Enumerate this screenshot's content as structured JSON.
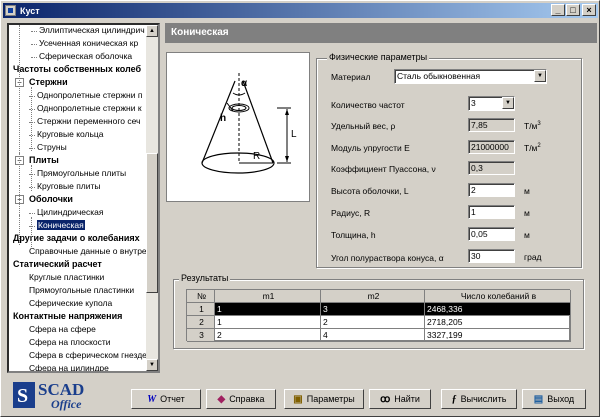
{
  "window": {
    "title": "Куст",
    "minimize": "_",
    "maximize": "□",
    "close": "×"
  },
  "tree": {
    "items": [
      {
        "label": "Эллиптическая цилиндрич",
        "level": 3,
        "bold": false
      },
      {
        "label": "Усеченная коническая кр",
        "level": 3,
        "bold": false
      },
      {
        "label": "Сферическая оболочка",
        "level": 3,
        "bold": false
      },
      {
        "label": "Частоты собственных колеб",
        "level": 0,
        "bold": true
      },
      {
        "label": "Стержни",
        "level": 1,
        "bold": true,
        "expander": "−"
      },
      {
        "label": "Однопролетные стержни п",
        "level": 2,
        "bold": false
      },
      {
        "label": "Однопролетные стержни к",
        "level": 2,
        "bold": false
      },
      {
        "label": "Стержни переменного сеч",
        "level": 2,
        "bold": false
      },
      {
        "label": "Круговые кольца",
        "level": 2,
        "bold": false
      },
      {
        "label": "Струны",
        "level": 2,
        "bold": false
      },
      {
        "label": "Плиты",
        "level": 1,
        "bold": true,
        "expander": "−"
      },
      {
        "label": "Прямоугольные плиты",
        "level": 2,
        "bold": false
      },
      {
        "label": "Круговые плиты",
        "level": 2,
        "bold": false
      },
      {
        "label": "Оболочки",
        "level": 1,
        "bold": true,
        "expander": "−"
      },
      {
        "label": "Цилиндрическая",
        "level": 2,
        "bold": false
      },
      {
        "label": "Коническая",
        "level": 2,
        "bold": false,
        "selected": true
      },
      {
        "label": "Другие задачи о колебаниях",
        "level": 0,
        "bold": true
      },
      {
        "label": "Справочные данные о внутре",
        "level": 1,
        "bold": false
      },
      {
        "label": "Статический расчет",
        "level": 0,
        "bold": true
      },
      {
        "label": "Круглые пластинки",
        "level": 1,
        "bold": false
      },
      {
        "label": "Прямоугольные пластинки",
        "level": 1,
        "bold": false
      },
      {
        "label": "Сферические купола",
        "level": 1,
        "bold": false
      },
      {
        "label": "Контактные напряжения",
        "level": 0,
        "bold": true
      },
      {
        "label": "Сфера на сфере",
        "level": 1,
        "bold": false
      },
      {
        "label": "Сфера на плоскости",
        "level": 1,
        "bold": false
      },
      {
        "label": "Сфера в сферическом гнезде",
        "level": 1,
        "bold": false
      },
      {
        "label": "Сфера на цилиндре",
        "level": 1,
        "bold": false
      }
    ]
  },
  "panel": {
    "title": "Коническая"
  },
  "figure": {
    "alpha": "α",
    "h": "h",
    "L": "L",
    "R": "R"
  },
  "params": {
    "legend": "Физические параметры",
    "material_label": "Материал",
    "material_value": "Сталь обыкновенная",
    "freq_label": "Количество частот",
    "freq_value": "3",
    "weight_label": "Удельный вес, ρ",
    "weight_value": "7,85",
    "weight_unit": "T/м",
    "weight_unit_sup": "3",
    "modulus_label": "Модуль упругости E",
    "modulus_value": "21000000",
    "modulus_unit": "T/м",
    "modulus_unit_sup": "2",
    "poisson_label": "Коэффициент Пуассона, ν",
    "poisson_value": "0,3",
    "height_label": "Высота оболочки, L",
    "height_value": "2",
    "height_unit": "м",
    "radius_label": "Радиус, R",
    "radius_value": "1",
    "radius_unit": "м",
    "thick_label": "Толщина, h",
    "thick_value": "0,05",
    "thick_unit": "м",
    "angle_label": "Угол полураствора конуса, α",
    "angle_value": "30",
    "angle_unit": "град"
  },
  "results": {
    "legend": "Результаты",
    "headers": [
      "№",
      "m1",
      "m2",
      "Число колебаний в"
    ],
    "rows": [
      [
        "1",
        "1",
        "3",
        "2468,336"
      ],
      [
        "2",
        "1",
        "2",
        "2718,205"
      ],
      [
        "3",
        "2",
        "4",
        "3327,199"
      ]
    ]
  },
  "logo": {
    "text1": "SCAD",
    "text2": "Office"
  },
  "buttons": {
    "report": "Отчет",
    "help": "Справка",
    "params": "Параметры",
    "find": "Найти",
    "calc": "Вычислить",
    "exit": "Выход"
  },
  "colors": {
    "titlebar": "#0a246a",
    "header": "#808080",
    "selection": "#0a246a"
  }
}
